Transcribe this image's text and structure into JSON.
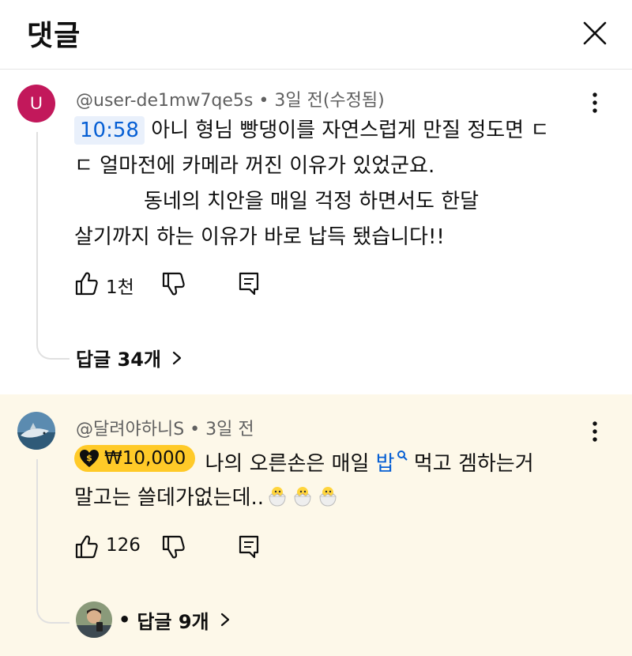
{
  "header": {
    "title": "댓글"
  },
  "comments": [
    {
      "avatar_letter": "U",
      "avatar_color": "#c2185b",
      "meta": "@user-de1mw7qe5s • 3일 전(수정됨)",
      "timestamp": "10:58",
      "line1_text": "아니 형님 빵댕이를 자연스럽게 만질 정도면 ㄷ",
      "line2_text": "ㄷ 얼마전에 카메라 꺼진 이유가 있었군요.",
      "line3_text": "동네의 치안을 매일 걱정 하면서도 한달",
      "line4_text": "살기까지 하는 이유가 바로 납득 됐습니다!!",
      "likes": "1천",
      "replies_label": "답글 34개"
    },
    {
      "meta": "@달려야하니S • 3일 전",
      "donation": "₩10,000",
      "line1_pre": "나의 오른손은 매일 ",
      "line1_link": "밥",
      "line1_post": " 먹고 겜하는거",
      "line2_text": "말고는  쓸데가없는데..",
      "likes": "126",
      "replies_dot": "•",
      "replies_label": "답글 9개"
    }
  ],
  "icons": {
    "close": "close-icon",
    "more": "more-vert-icon",
    "like": "thumb-up-icon",
    "dislike": "thumb-down-icon",
    "reply": "comment-icon",
    "chevron": "chevron-right-icon",
    "donation": "money-heart-icon",
    "search": "search-icon",
    "emoji": "hatching-chick-emoji"
  },
  "colors": {
    "accent_link": "#065fd4",
    "timestamp_bg": "#e9f0fb",
    "donation_bg": "#ffca28",
    "highlight_bg": "#fdf8e9"
  }
}
